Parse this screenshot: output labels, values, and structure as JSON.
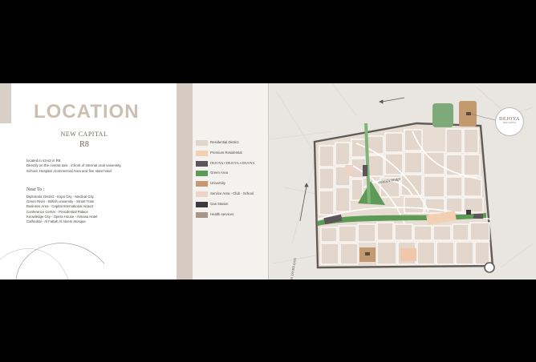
{
  "left": {
    "title": "LOCATION",
    "subtitle": "NEW CAPITAL",
    "zone": "R8",
    "description": [
      "located in s3-s3 in R8",
      "Directly on the central axis , infront of Internat onal university,",
      "School, Hospital ,Commercial Area and five stars hotel."
    ],
    "near_heading": "Near To :",
    "near_items": [
      "Diplomatic District - Expo City - Medical City",
      "Green River - British university - Smart Train",
      "Business Area - Capital International Airport",
      "Conference Center - Presidential Palace",
      "Knowledge City - Opera House - Almasa Hotel",
      "Cathedral - Al Fattah Al Aleem Mosque"
    ]
  },
  "legend": [
    {
      "label": "Residential District",
      "color": "#e2d6cc"
    },
    {
      "label": "Premium Residential",
      "color": "#f3cfb3"
    },
    {
      "label": "DEJOYA • DEJOYA • DEJOYA",
      "color": "#5c5658"
    },
    {
      "label": "Green Area",
      "color": "#5d9a58"
    },
    {
      "label": "University",
      "color": "#c39a70"
    },
    {
      "label": "Service Area - Club - School",
      "color": "#efd3c9"
    },
    {
      "label": "Gas Station",
      "color": "#3d3b3c"
    },
    {
      "label": "Health services",
      "color": "#a89587"
    }
  ],
  "map": {
    "road_top": "GREEN RIVER",
    "road_left": "BIN ZAYED AXIS",
    "badge_name": "DEJOYA",
    "badge_sub": "NEW CAPITAL",
    "colors": {
      "block": "#e3d7cd",
      "road": "#ffffff",
      "green": "#5d9a58",
      "premium": "#f3cfb3",
      "university": "#c39a70",
      "border": "#5f5b58"
    }
  }
}
